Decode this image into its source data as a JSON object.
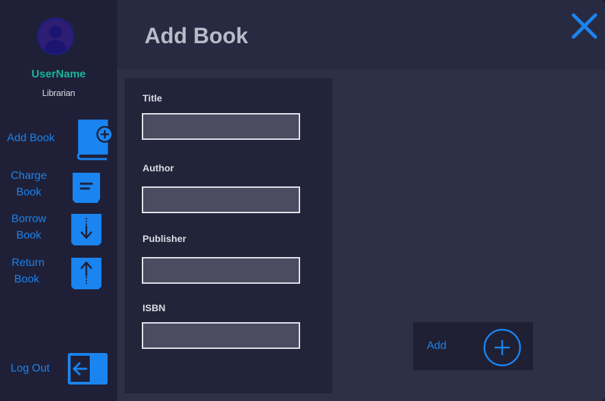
{
  "user": {
    "name": "UserName",
    "role": "Librarian"
  },
  "sidebar": {
    "items": [
      {
        "label_line1": "Add Book",
        "label_line2": "",
        "icon": "add-book-icon"
      },
      {
        "label_line1": "Charge",
        "label_line2": "Book",
        "icon": "charge-book-icon"
      },
      {
        "label_line1": "Borrow",
        "label_line2": "Book",
        "icon": "borrow-book-icon"
      },
      {
        "label_line1": "Return",
        "label_line2": "Book",
        "icon": "return-book-icon"
      }
    ],
    "logout_label": "Log Out",
    "logout_icon": "logout-icon"
  },
  "header": {
    "title": "Add Book",
    "close_icon": "close-icon"
  },
  "form": {
    "fields": [
      {
        "label": "Title",
        "value": "",
        "placeholder": ""
      },
      {
        "label": "Author",
        "value": "",
        "placeholder": ""
      },
      {
        "label": "Publisher",
        "value": "",
        "placeholder": ""
      },
      {
        "label": "ISBN",
        "value": "",
        "placeholder": ""
      }
    ]
  },
  "actions": {
    "add_label": "Add",
    "add_icon": "plus-circle-icon"
  },
  "colors": {
    "accent": "#1a84f0",
    "username": "#19b29a",
    "sidebar_bg": "#1f2038",
    "main_bg": "#2e3046",
    "panel_bg": "#22243a"
  }
}
